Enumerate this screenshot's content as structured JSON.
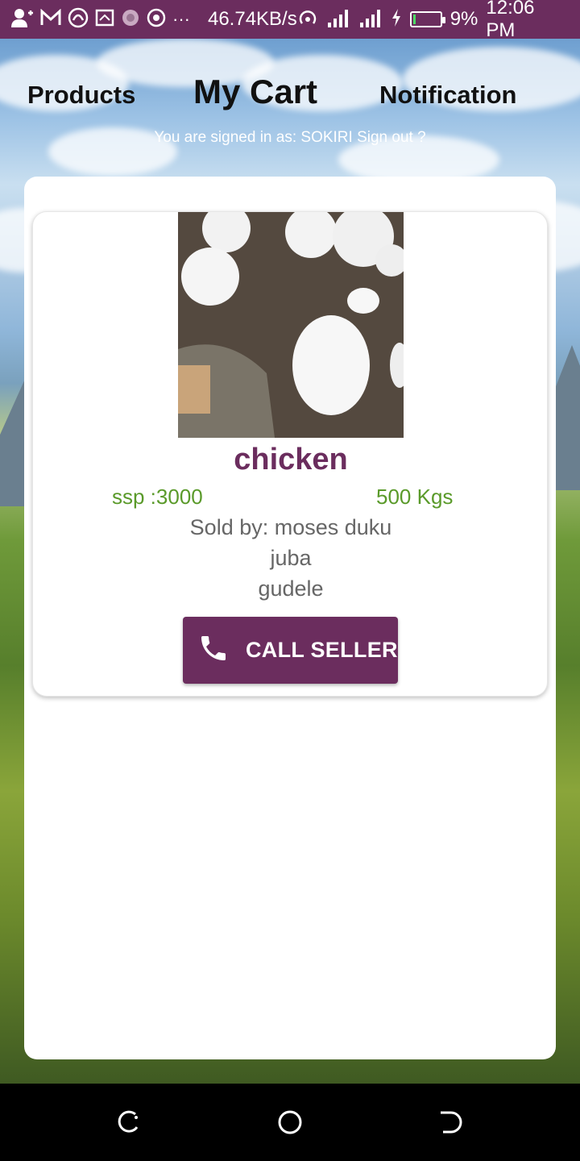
{
  "status_bar": {
    "net_speed": "46.74KB/s",
    "battery": "9%",
    "time": "12:06 PM",
    "dots": "···"
  },
  "header": {
    "tab_products": "Products",
    "tab_cart": "My Cart",
    "tab_notification": "Notification",
    "signed_in_prefix": "You are signed in as:",
    "username": "SOKIRI",
    "sign_out": "Sign out ?"
  },
  "cart": {
    "items": [
      {
        "name": "chicken",
        "price": "ssp :3000",
        "quantity": "500 Kgs",
        "seller": "Sold by: moses duku",
        "city": "juba",
        "area": "gudele",
        "call_label": "CALL SELLER"
      }
    ]
  },
  "colors": {
    "brand": "#6b2d5e",
    "accent_green": "#5a9a2a",
    "muted_text": "#666666"
  },
  "icons": {
    "call_button": "phone-icon",
    "nav": [
      "recent-apps-icon",
      "home-icon",
      "back-icon"
    ]
  }
}
